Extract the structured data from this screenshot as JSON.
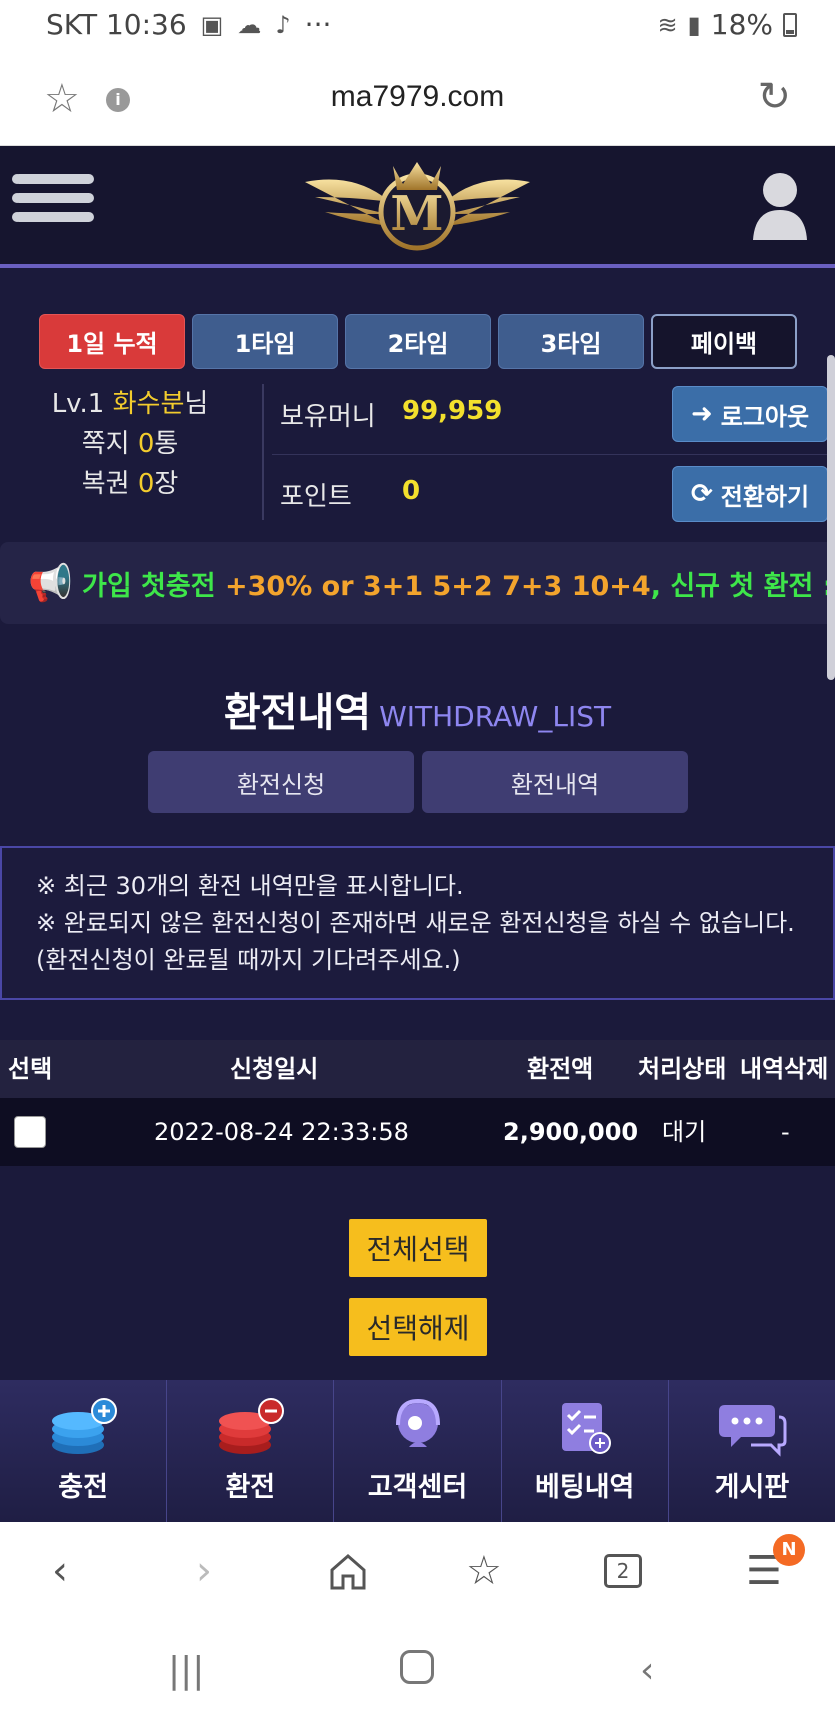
{
  "status_bar": {
    "carrier_time": "SKT 10:36",
    "dots": "···",
    "battery": "18%"
  },
  "browser": {
    "url": "ma7979.com"
  },
  "tabs": [
    {
      "label": "1일 누적"
    },
    {
      "label": "1타임"
    },
    {
      "label": "2타임"
    },
    {
      "label": "3타임"
    },
    {
      "label": "페이백"
    }
  ],
  "user": {
    "level": "Lv.1 ",
    "name": "화수분",
    "honorific": "님",
    "messages_label": "쪽지 ",
    "messages_count": "0",
    "messages_unit": "통",
    "coupons_label": "복권 ",
    "coupons_count": "0",
    "coupons_unit": "장",
    "money_label": "보유머니",
    "money_value": "99,959",
    "point_label": "포인트",
    "point_value": "0",
    "logout_label": "로그아웃",
    "convert_label": "전환하기"
  },
  "marquee": {
    "part1": "가입 첫충전 ",
    "part2": "+30% or 3+1  5+2  7+3  10+4",
    "part3": ", 신규 첫 환전 :"
  },
  "page": {
    "title_ko": "환전내역",
    "title_en": "WITHDRAW_LIST",
    "subnav_request": "환전신청",
    "subnav_history": "환전내역"
  },
  "notice": {
    "line1": "※ 최근 30개의 환전 내역만을 표시합니다.",
    "line2": "※ 완료되지 않은 환전신청이 존재하면 새로운 환전신청을 하실 수 없습니다.",
    "line3": "(환전신청이 완료될 때까지 기다려주세요.)"
  },
  "table": {
    "headers": {
      "select": "선택",
      "date": "신청일시",
      "amount": "환전액",
      "status": "처리상태",
      "delete": "내역삭제"
    },
    "rows": [
      {
        "date": "2022-08-24 22:33:58",
        "amount": "2,900,000",
        "status": "대기",
        "delete": "-"
      }
    ]
  },
  "actions": {
    "select_all": "전체선택",
    "deselect": "선택해제"
  },
  "bottom_nav": [
    {
      "label": "충전",
      "icon": "charge-coins-icon"
    },
    {
      "label": "환전",
      "icon": "withdraw-coins-icon"
    },
    {
      "label": "고객센터",
      "icon": "support-headset-icon"
    },
    {
      "label": "베팅내역",
      "icon": "bet-history-icon"
    },
    {
      "label": "게시판",
      "icon": "board-chat-icon"
    }
  ],
  "browser_bottom": {
    "tabs_count": "2",
    "menu_badge": "N"
  },
  "colors": {
    "accent": "#6a5fc0",
    "highlight": "#f3cc2d",
    "button_yellow": "#f6be1d",
    "tab_active": "#d93a3a"
  }
}
